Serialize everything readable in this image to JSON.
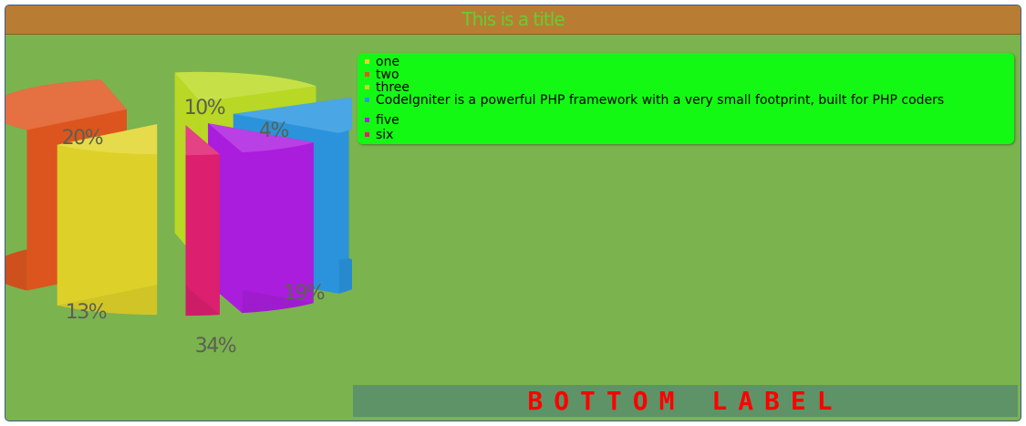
{
  "title": "This is a title",
  "bottom_label": "BOTTOM LABEL",
  "colors": {
    "frame_background": "#7bb34f",
    "title_bar": "#b87d33",
    "title_text": "#66cc33",
    "legend_background": "#14f914",
    "bottom_band": "#5e9368",
    "bottom_label_text": "#ff0000"
  },
  "chart_data": {
    "type": "pie",
    "style": "3d-exploded",
    "legend_position": "top-right",
    "labels": [
      "one",
      "two",
      "three",
      "CodeIgniter is a powerful PHP framework with a very small footprint, built for PHP coders",
      "five",
      "six"
    ],
    "values": [
      13,
      34,
      19,
      20,
      10,
      4
    ],
    "percent_labels": [
      "13%",
      "34%",
      "19%",
      "20%",
      "10%",
      "4%"
    ],
    "colors": [
      "#e2d52a",
      "#e0571f",
      "#bcdc26",
      "#2b96e0",
      "#ad1ee0",
      "#e02070"
    ]
  }
}
